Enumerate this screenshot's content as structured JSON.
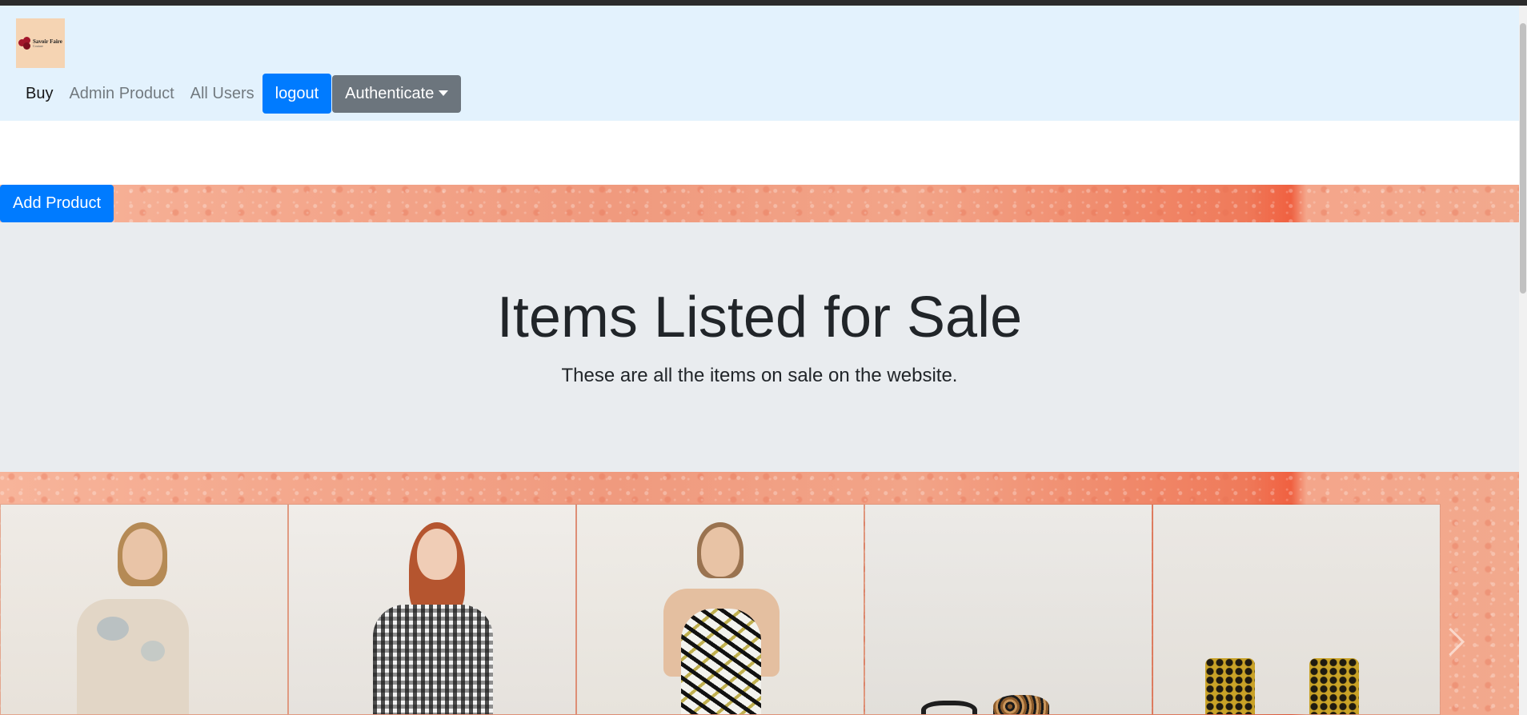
{
  "brand": {
    "logo_text": "Savoir Faire",
    "logo_subtext": "Couture"
  },
  "nav": {
    "links": [
      "Buy",
      "Admin Product",
      "All Users"
    ],
    "logout_label": "logout",
    "authenticate_label": "Authenticate"
  },
  "actions": {
    "add_product_label": "Add Product"
  },
  "jumbotron": {
    "title": "Items Listed for Sale",
    "subtitle": "These are all the items on sale on the website."
  },
  "colors": {
    "navbar_bg": "#e3f2fd",
    "primary": "#007bff",
    "secondary": "#6c757d",
    "jumbotron_bg": "#e9ecef"
  },
  "products": [
    {
      "icon": "dress-model-floral"
    },
    {
      "icon": "dress-model-gingham"
    },
    {
      "icon": "dress-model-palm-print"
    },
    {
      "icon": "leopard-sandals"
    },
    {
      "icon": "snakeskin-boots"
    }
  ]
}
